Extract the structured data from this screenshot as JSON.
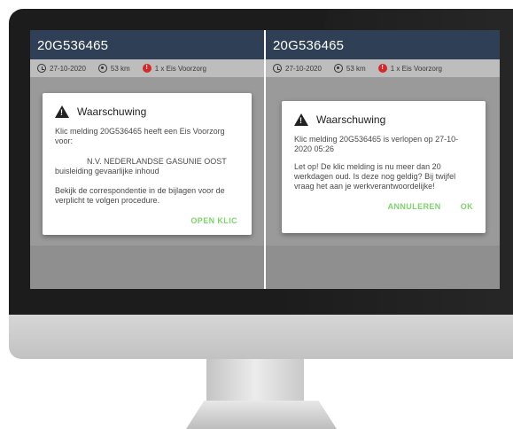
{
  "left_panel": {
    "title": "20G536465",
    "info": {
      "date": "27-10-2020",
      "distance": "53 km",
      "requirement": "1 x Eis Voorzorg"
    },
    "dialog": {
      "title": "Waarschuwing",
      "line1": "Klic melding 20G536465 heeft een Eis Voorzorg voor:",
      "line2": "N.V. NEDERLANDSE GASUNIE OOST",
      "line3": "buisleiding gevaarlijke inhoud",
      "line4": "Bekijk de correspondentie in de bijlagen voor de verplicht te volgen procedure.",
      "action": "OPEN KLIC"
    }
  },
  "right_panel": {
    "title": "20G536465",
    "info": {
      "date": "27-10-2020",
      "distance": "53 km",
      "requirement": "1 x Eis Voorzorg"
    },
    "dialog": {
      "title": "Waarschuwing",
      "line1": "Klic melding 20G536465 is verlopen op 27-10-2020 05:26",
      "line2": "Let op! De klic melding is nu meer dan 20 werkdagen oud. Is deze nog geldig? Bij twijfel vraag het aan je werkverantwoordelijke!",
      "cancel": "ANNULEREN",
      "ok": "OK"
    }
  },
  "colors": {
    "appbar": "#2f3f55",
    "accent_green": "#7ed36b",
    "alert_red": "#d62828"
  }
}
